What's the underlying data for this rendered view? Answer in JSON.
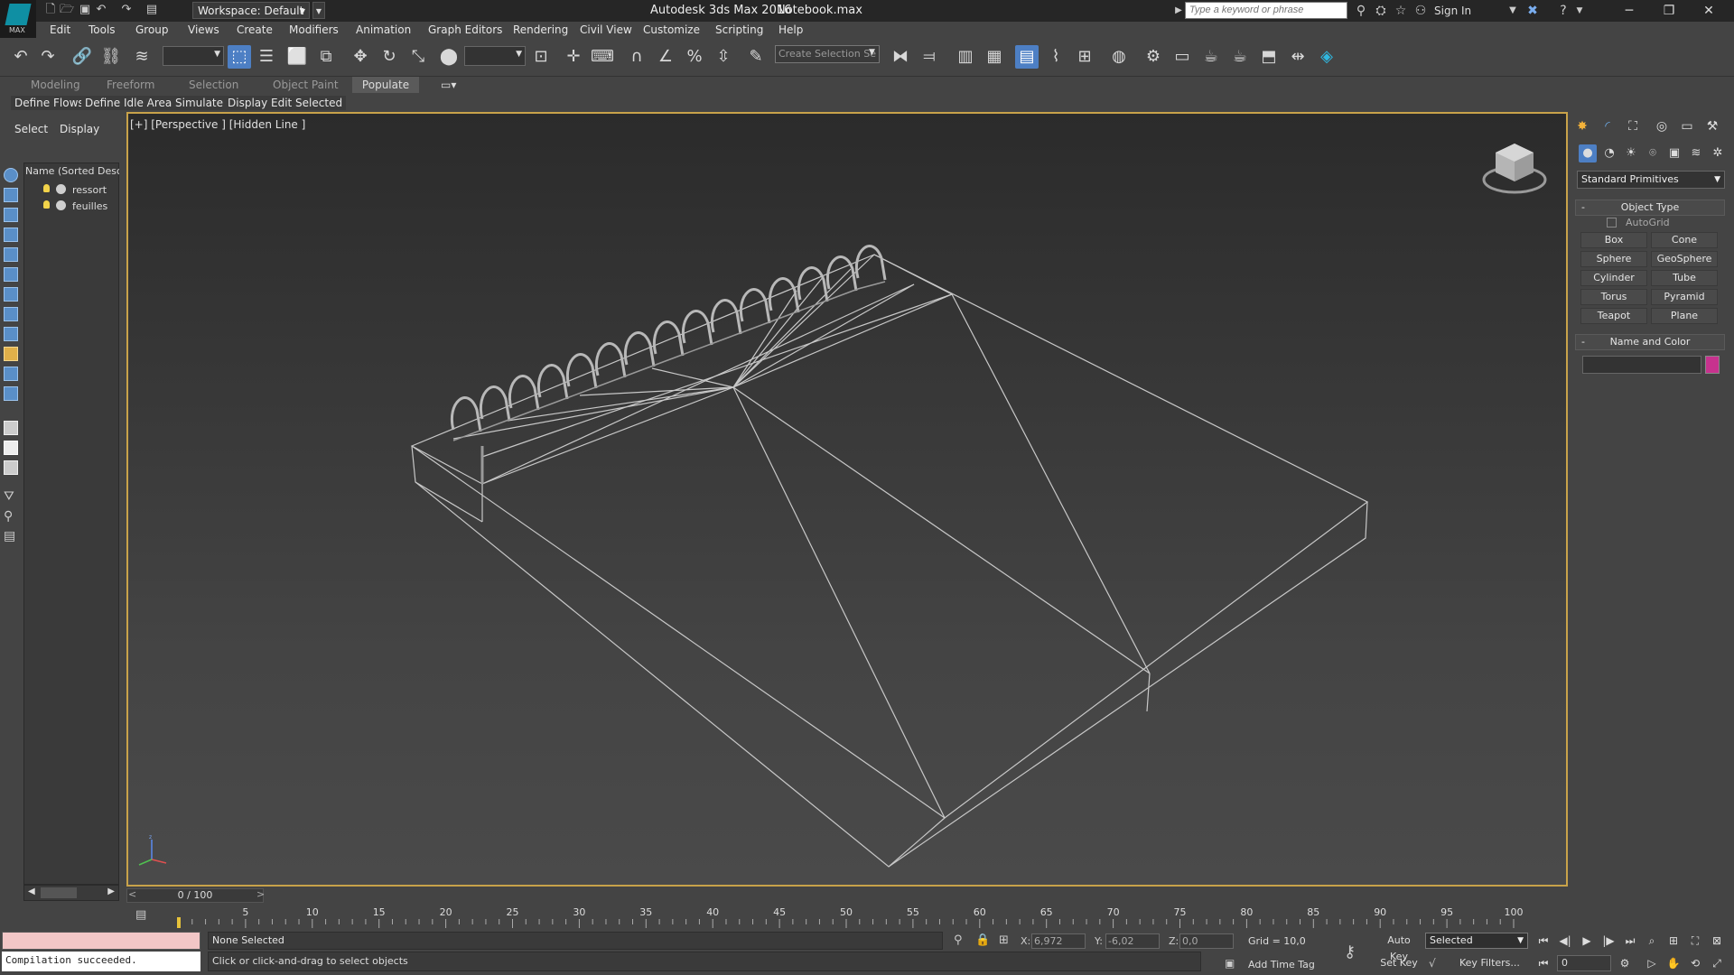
{
  "title_bar": {
    "logo_label": "MAX",
    "workspace_label": "Workspace: Default",
    "app_title": "Autodesk 3ds Max 2016",
    "file_name": "Notebook.max",
    "search_placeholder": "Type a keyword or phrase",
    "sign_in": "Sign In"
  },
  "menu": [
    "Edit",
    "Tools",
    "Group",
    "Views",
    "Create",
    "Modifiers",
    "Animation",
    "Graph Editors",
    "Rendering",
    "Civil View",
    "Customize",
    "Scripting",
    "Help"
  ],
  "toolbar": {
    "create_selection_set": "Create Selection Se"
  },
  "ribbon": {
    "tabs": [
      "Modeling",
      "Freeform",
      "Selection",
      "Object Paint",
      "Populate"
    ],
    "active_tab": "Populate",
    "buttons": [
      "Define Flows",
      "Define Idle Areas",
      "Simulate",
      "Display",
      "Edit Selected"
    ]
  },
  "scene_explorer": {
    "tabs": [
      "Select",
      "Display"
    ],
    "column_header": "Name (Sorted Descer",
    "items": [
      {
        "name": "ressort"
      },
      {
        "name": "feuilles"
      }
    ]
  },
  "viewport": {
    "label": "[+] [Perspective ] [Hidden Line ]"
  },
  "command_panel": {
    "category_dropdown": "Standard Primitives",
    "object_type_title": "Object Type",
    "autogrid_label": "AutoGrid",
    "primitives": [
      "Box",
      "Cone",
      "Sphere",
      "GeoSphere",
      "Cylinder",
      "Tube",
      "Torus",
      "Pyramid",
      "Teapot",
      "Plane"
    ],
    "name_color_title": "Name and Color",
    "object_color": "#c7328e"
  },
  "timeline": {
    "frame_display": "0 / 100",
    "scroll_left": "<",
    "scroll_right": ">",
    "ruler_ticks": [
      "5",
      "10",
      "15",
      "20",
      "25",
      "30",
      "35",
      "40",
      "45",
      "50",
      "55",
      "60",
      "65",
      "70",
      "75",
      "80",
      "85",
      "90",
      "95",
      "100"
    ],
    "ruler_max": 100
  },
  "status": {
    "maxscript_output": "Compilation succeeded.",
    "selection_status": "None Selected",
    "prompt": "Click or click-and-drag to select objects",
    "x_label": "X:",
    "x_value": "6,972",
    "y_label": "Y:",
    "y_value": "-6,02",
    "z_label": "Z:",
    "z_value": "0,0",
    "grid": "Grid = 10,0",
    "add_time_tag": "Add Time Tag",
    "auto_key": "Auto Key",
    "set_key": "Set Key",
    "key_mode": "Selected",
    "key_filters": "Key Filters...",
    "current_frame": "0"
  }
}
